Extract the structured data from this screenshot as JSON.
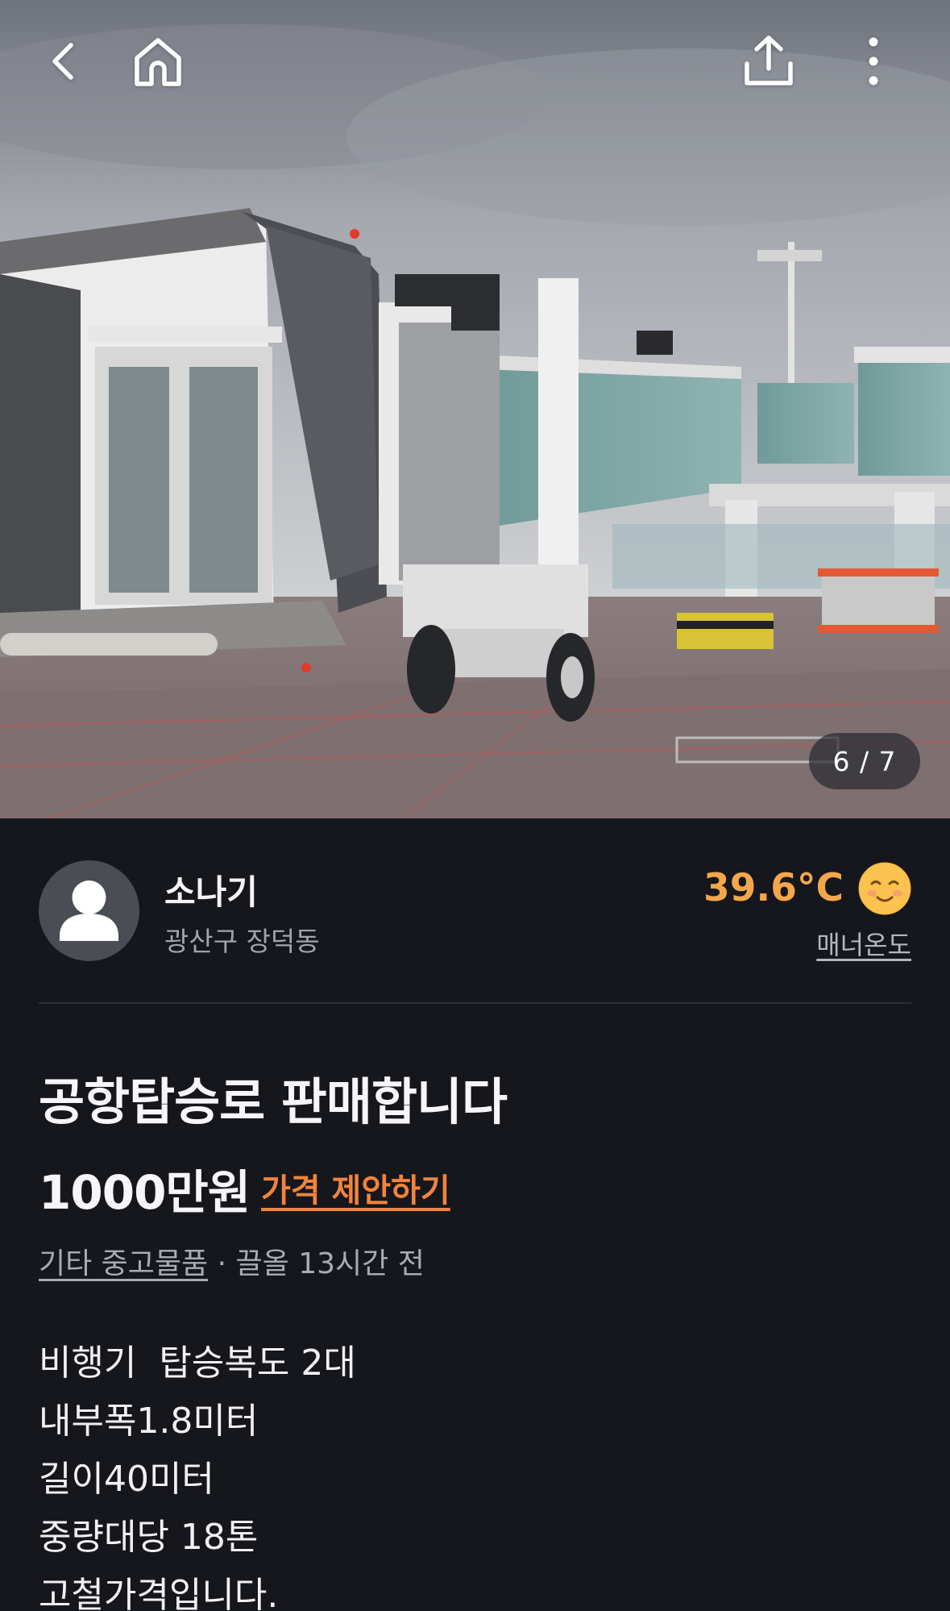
{
  "topbar": {
    "back_icon": "chevron-left-icon",
    "home_icon": "home-icon",
    "share_icon": "share-upload-icon",
    "more_icon": "more-vertical-icon"
  },
  "photo": {
    "counter": "6 / 7",
    "current_index": 6,
    "total": 7
  },
  "seller": {
    "nickname": "소나기",
    "region": "광산구 장덕동",
    "temperature": "39.6°C",
    "temperature_label": "매너온도",
    "temperature_color": "#f4a64c",
    "face_icon": "smiling-face-icon"
  },
  "article": {
    "title": "공항탑승로 판매합니다",
    "price": "1000만원",
    "offer_label": "가격 제안하기",
    "offer_color": "#f2843b",
    "category": "기타 중고물품",
    "separator": " · ",
    "bumped": "끌올 13시간 전",
    "description": [
      "비행기  탑승복도 2대",
      "내부폭1.8미터",
      "길이40미터",
      "중량대당 18톤",
      "고철가격입니다."
    ]
  }
}
